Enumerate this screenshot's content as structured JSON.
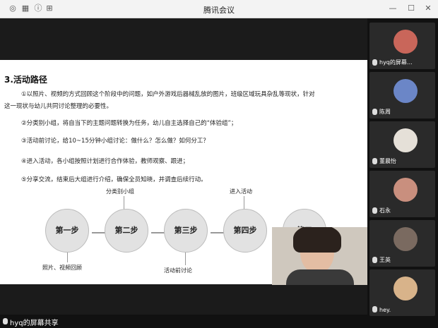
{
  "window": {
    "title": "腾讯会议"
  },
  "slide": {
    "heading": "3.活动路径",
    "paragraphs": [
      "①以照片、视频的方式回顾这个阶段中的问题，如户外游戏后器械乱放的图片，班级区域玩具杂乱等现状，针对",
      "这一现状与幼儿共同讨论整理的必要性。",
      "②分类别小组，将自当下的主题问题转换为任务，幼儿自主选择自己的“体验组”；",
      "③活动前讨论，给10~15分钟小组讨论：做什么？怎么做？如何分工？",
      "④进入活动，各小组按照计划进行合作体验，教师观察、跟进；",
      "⑤分享交流，结束后大组进行介绍，确保全员知晓，并调查后续行动。"
    ],
    "steps": [
      {
        "text": "第一步"
      },
      {
        "text": "第二步"
      },
      {
        "text": "第三步"
      },
      {
        "text": "第四步"
      },
      {
        "text": "第五"
      }
    ],
    "labels": {
      "above2": "分类别小组",
      "above4": "进入活动",
      "below1": "照片、视频回顾",
      "below3": "活动前讨论"
    }
  },
  "participants": [
    {
      "name": "hyq的屏幕…",
      "color": "#c9665a"
    },
    {
      "name": "陈周",
      "color": "#6b86c7"
    },
    {
      "name": "董晨怡",
      "color": "#e5e0d8"
    },
    {
      "name": "石永",
      "color": "#c98f7e"
    },
    {
      "name": "王英",
      "color": "#7a6a60"
    },
    {
      "name": "hey.",
      "color": "#d8b38a"
    }
  ],
  "status": {
    "share_label": "hyq的屏幕共享"
  }
}
